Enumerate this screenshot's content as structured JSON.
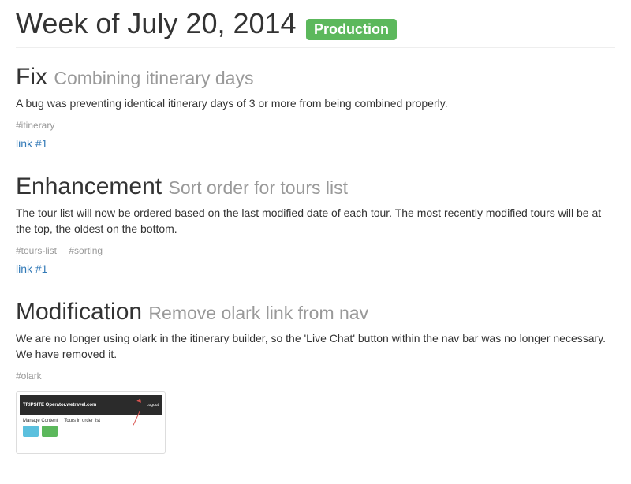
{
  "header": {
    "title": "Week of July 20, 2014",
    "badge": "Production"
  },
  "entries": [
    {
      "category": "Fix",
      "subtitle": "Combining itinerary days",
      "body": "A bug was preventing identical itinerary days of 3 or more from being combined properly.",
      "tags": [
        "#itinerary"
      ],
      "link": "link #1"
    },
    {
      "category": "Enhancement",
      "subtitle": "Sort order for tours list",
      "body": "The tour list will now be ordered based on the last modified date of each tour. The most recently modified tours will be at the top, the oldest on the bottom.",
      "tags": [
        "#tours-list",
        "#sorting"
      ],
      "link": "link #1"
    },
    {
      "category": "Modification",
      "subtitle": "Remove olark link from nav",
      "body": "We are no longer using olark in the itinerary builder, so the 'Live Chat' button within the nav bar was no longer necessary. We have removed it.",
      "tags": [
        "#olark"
      ],
      "link": null
    }
  ],
  "thumb": {
    "navLeft": "TRIPSITE  Operator.wetravel.com",
    "navRight": "Logout",
    "lower1": "Manage Content",
    "lower2": "Tours  in order list"
  }
}
